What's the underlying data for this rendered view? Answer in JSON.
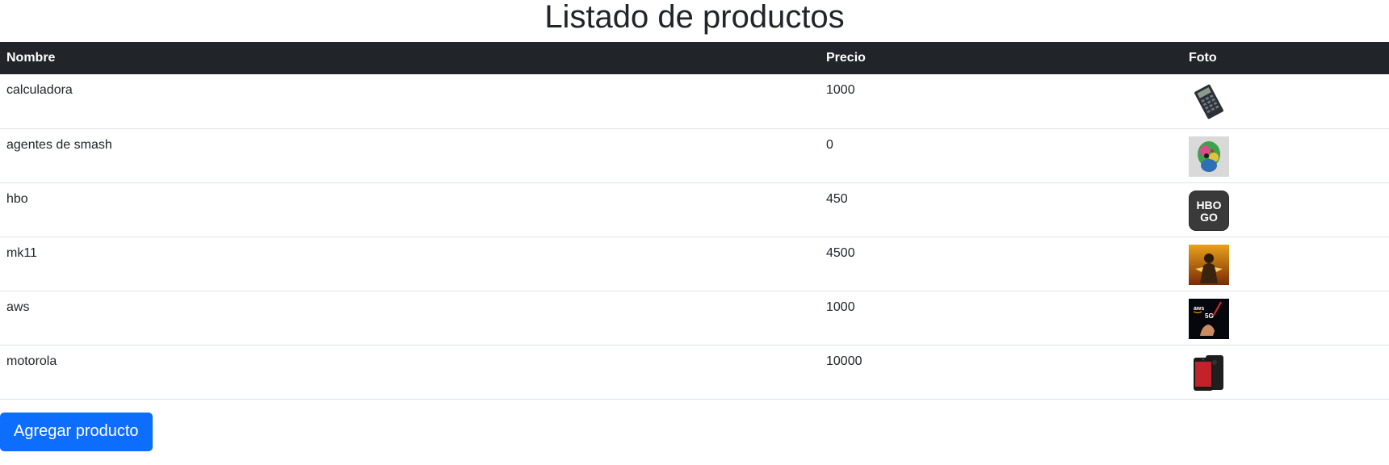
{
  "page": {
    "title": "Listado de productos"
  },
  "table": {
    "headers": {
      "name": "Nombre",
      "price": "Precio",
      "photo": "Foto"
    },
    "rows": [
      {
        "name": "calculadora",
        "price": "1000",
        "photo_icon": "calculator-photo"
      },
      {
        "name": "agentes de smash",
        "price": "0",
        "photo_icon": "colorful-character-photo"
      },
      {
        "name": "hbo",
        "price": "450",
        "photo_icon": "hbo-go-logo-photo"
      },
      {
        "name": "mk11",
        "price": "4500",
        "photo_icon": "mk11-fighter-photo"
      },
      {
        "name": "aws",
        "price": "1000",
        "photo_icon": "aws-5g-photo"
      },
      {
        "name": "motorola",
        "price": "10000",
        "photo_icon": "red-phone-photo"
      }
    ]
  },
  "actions": {
    "add_label": "Agregar producto"
  },
  "colors": {
    "header_bg": "#212529",
    "button_bg": "#0d6efd",
    "row_border": "#dee2e6"
  }
}
